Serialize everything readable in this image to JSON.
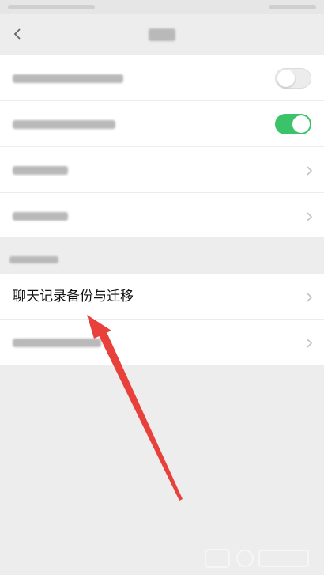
{
  "status_bar": {},
  "nav": {
    "title": "",
    "back_icon": "chevron-left-icon"
  },
  "settings_group": {
    "items": [
      {
        "name": "setting-row-1",
        "label": "",
        "control": "toggle",
        "toggle_on": false
      },
      {
        "name": "setting-row-2",
        "label": "",
        "control": "toggle",
        "toggle_on": true
      },
      {
        "name": "setting-row-3",
        "label": "",
        "control": "chevron"
      },
      {
        "name": "setting-row-4",
        "label": "",
        "control": "chevron"
      }
    ]
  },
  "chat_history_section": {
    "header": "",
    "items": [
      {
        "name": "chat-history-backup-migrate",
        "label": "聊天记录备份与迁移",
        "control": "chevron"
      },
      {
        "name": "clear-chat-history",
        "label": "",
        "control": "chevron"
      }
    ]
  },
  "annotation": {
    "type": "red-arrow",
    "color": "#e8403a"
  },
  "colors": {
    "background": "#ededed",
    "card": "#ffffff",
    "toggle_on": "#3cc36a",
    "arrow": "#e8403a"
  }
}
